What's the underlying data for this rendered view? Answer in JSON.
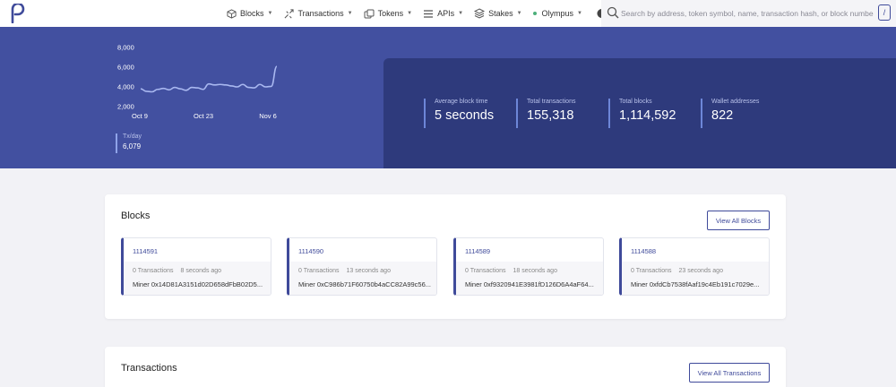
{
  "nav": {
    "items": [
      {
        "label": "Blocks",
        "icon": "cube-icon"
      },
      {
        "label": "Transactions",
        "icon": "transactions-icon"
      },
      {
        "label": "Tokens",
        "icon": "tokens-icon"
      },
      {
        "label": "APIs",
        "icon": "list-icon"
      },
      {
        "label": "Stakes",
        "icon": "layers-icon"
      }
    ],
    "network": "Olympus",
    "network_status_color": "#4caf7a"
  },
  "search": {
    "placeholder": "Search by address, token symbol, name, transaction hash, or block number",
    "shortcut": "/"
  },
  "chart_data": {
    "type": "line",
    "x": [
      "Oct 9",
      "Oct 23",
      "Nov 6"
    ],
    "yticks": [
      "8,000",
      "6,000",
      "4,000",
      "2,000"
    ],
    "ylim": [
      2000,
      8000
    ],
    "values": [
      3800,
      3550,
      3500,
      3750,
      3850,
      3700,
      3950,
      3800,
      3650,
      3950,
      3900,
      3750,
      4300,
      4200,
      4250,
      4200,
      4100,
      4000,
      4250,
      3950,
      3900,
      4250,
      4000,
      4050,
      6079
    ],
    "line_color": "#a9b8f0"
  },
  "txday": {
    "label": "Tx/day",
    "value": "6,079"
  },
  "stats": [
    {
      "label": "Average block time",
      "value": "5 seconds"
    },
    {
      "label": "Total transactions",
      "value": "155,318"
    },
    {
      "label": "Total blocks",
      "value": "1,114,592"
    },
    {
      "label": "Wallet addresses",
      "value": "822"
    }
  ],
  "blocks_section": {
    "title": "Blocks",
    "view_all": "View All Blocks",
    "blocks": [
      {
        "number": "1114591",
        "txs": "0 Transactions",
        "ago": "8 seconds ago",
        "miner": "Miner 0x14D81A3151d02D658dFbB02D5..."
      },
      {
        "number": "1114590",
        "txs": "0 Transactions",
        "ago": "13 seconds ago",
        "miner": "Miner 0xC986b71F60750b4aCC82A99c56..."
      },
      {
        "number": "1114589",
        "txs": "0 Transactions",
        "ago": "18 seconds ago",
        "miner": "Miner 0xf9320941E3981fD126D6A4aF64..."
      },
      {
        "number": "1114588",
        "txs": "0 Transactions",
        "ago": "23 seconds ago",
        "miner": "Miner 0xfdCb7538fAaf19c4Eb191c7029e..."
      }
    ]
  },
  "transactions_section": {
    "title": "Transactions",
    "view_all": "View All Transactions"
  },
  "colors": {
    "hero": "#4250a0",
    "stats_panel": "#2e3a7c",
    "accent": "#3f4a9a"
  }
}
